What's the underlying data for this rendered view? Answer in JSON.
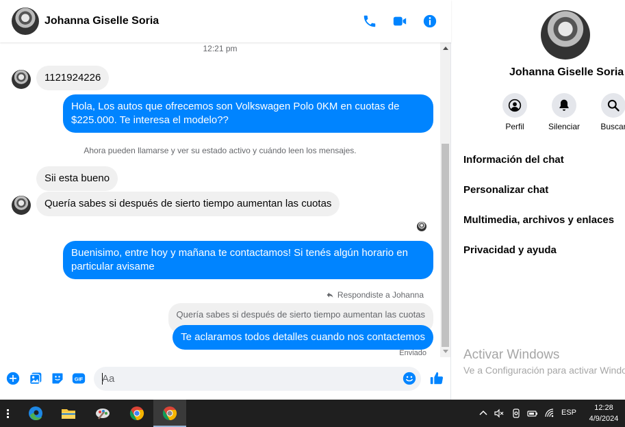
{
  "header": {
    "contact_name": "Johanna Giselle Soria",
    "icons": [
      "phone-icon",
      "video-icon",
      "info-icon"
    ]
  },
  "conversation": {
    "timestamp": "12:21 pm",
    "messages": [
      {
        "direction": "in",
        "text": "1121924226"
      },
      {
        "direction": "out",
        "text": "Hola, Los autos que ofrecemos son Volkswagen Polo 0KM en cuotas de $225.000. Te interesa el modelo??"
      },
      {
        "direction": "in",
        "text": "Sii esta bueno"
      },
      {
        "direction": "in",
        "text": "Quería sabes si después de sierto tiempo aumentan las cuotas"
      },
      {
        "direction": "out",
        "text": "Buenisimo, entre hoy y mañana te contactamos! Si tenés algún horario en particular avisame"
      },
      {
        "direction": "out",
        "text": "Te aclaramos todos detalles cuando nos contactemos"
      }
    ],
    "system_note": "Ahora pueden llamarse y ver su estado activo y cuándo leen los mensajes.",
    "reply_label": "Respondiste a Johanna",
    "quoted_text": "Quería sabes si después de sierto tiempo aumentan las cuotas",
    "status": "Enviado"
  },
  "composer": {
    "placeholder": "Aa",
    "icons": [
      "plus-icon",
      "image-icon",
      "sticker-icon",
      "gif-icon",
      "emoji-icon",
      "like-icon"
    ],
    "gif_label": "GIF"
  },
  "info_panel": {
    "name": "Johanna Giselle Soria",
    "actions": [
      {
        "label": "Perfil",
        "icon": "profile-icon"
      },
      {
        "label": "Silenciar",
        "icon": "bell-icon"
      },
      {
        "label": "Buscar",
        "icon": "search-icon"
      }
    ],
    "menu": [
      "Información del chat",
      "Personalizar chat",
      "Multimedia, archivos y enlaces",
      "Privacidad y ayuda"
    ]
  },
  "watermark": {
    "title": "Activar Windows",
    "subtitle": "Ve a Configuración para activar Windows."
  },
  "taskbar": {
    "language": "ESP",
    "time": "12:28",
    "date": "4/9/2024"
  },
  "colors": {
    "accent": "#0084ff",
    "incoming_bubble": "#f0f0f0",
    "taskbar": "#1f1f1f"
  }
}
